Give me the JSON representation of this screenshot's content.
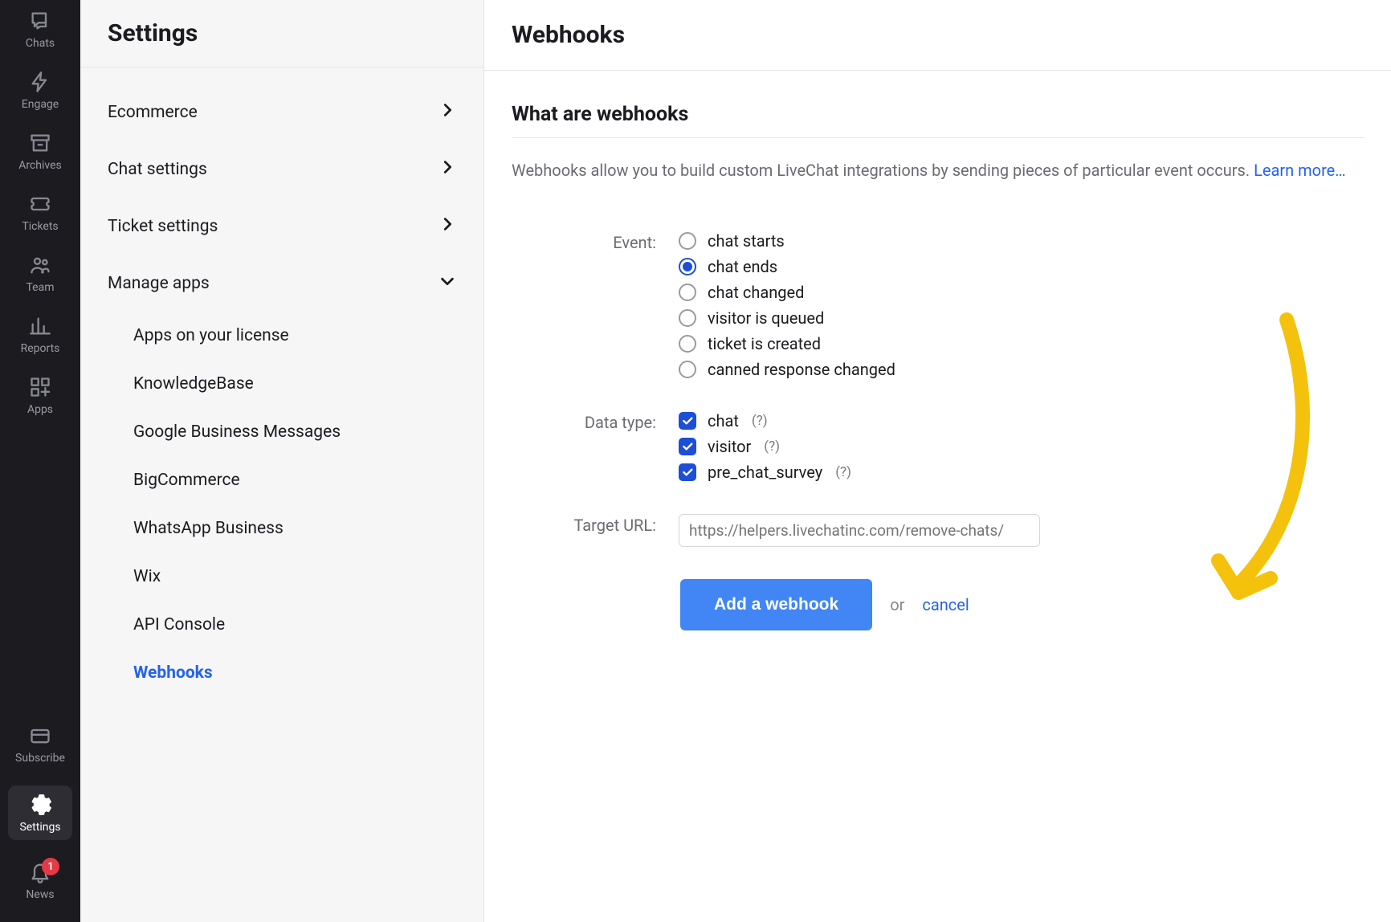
{
  "rail": {
    "items": [
      {
        "label": "Chats"
      },
      {
        "label": "Engage"
      },
      {
        "label": "Archives"
      },
      {
        "label": "Tickets"
      },
      {
        "label": "Team"
      },
      {
        "label": "Reports"
      },
      {
        "label": "Apps"
      }
    ],
    "bottom": [
      {
        "label": "Subscribe"
      },
      {
        "label": "Settings",
        "active": true
      },
      {
        "label": "News",
        "badge": "1"
      }
    ]
  },
  "sidebar": {
    "title": "Settings",
    "groups": [
      {
        "label": "Ecommerce",
        "chevron": "right"
      },
      {
        "label": "Chat settings",
        "chevron": "right"
      },
      {
        "label": "Ticket settings",
        "chevron": "right"
      },
      {
        "label": "Manage apps",
        "chevron": "down",
        "items": [
          "Apps on your license",
          "KnowledgeBase",
          "Google Business Messages",
          "BigCommerce",
          "WhatsApp Business",
          "Wix",
          "API Console",
          "Webhooks"
        ],
        "active_item": "Webhooks"
      }
    ]
  },
  "main": {
    "title": "Webhooks",
    "section_title": "What are webhooks",
    "description": "Webhooks allow you to build custom LiveChat integrations by sending pieces of particular event occurs. ",
    "learn_more": "Learn more…",
    "form": {
      "event_label": "Event:",
      "events": [
        {
          "label": "chat starts",
          "selected": false
        },
        {
          "label": "chat ends",
          "selected": true
        },
        {
          "label": "chat changed",
          "selected": false
        },
        {
          "label": "visitor is queued",
          "selected": false
        },
        {
          "label": "ticket is created",
          "selected": false
        },
        {
          "label": "canned response changed",
          "selected": false
        }
      ],
      "data_type_label": "Data type:",
      "data_types": [
        {
          "label": "chat",
          "help": "(?)",
          "checked": true
        },
        {
          "label": "visitor",
          "help": "(?)",
          "checked": true
        },
        {
          "label": "pre_chat_survey",
          "help": "(?)",
          "checked": true
        }
      ],
      "target_url_label": "Target URL:",
      "target_url_placeholder": "https://helpers.livechatinc.com/remove-chats/",
      "submit_label": "Add a webhook",
      "or_label": "or",
      "cancel_label": "cancel"
    }
  }
}
